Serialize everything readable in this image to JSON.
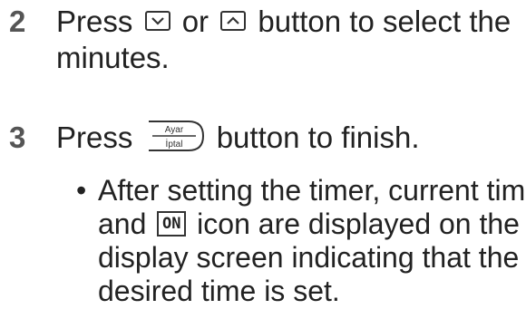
{
  "step2": {
    "number": "2",
    "line1_before": "Press ",
    "or_text": " or ",
    "line1_after": " button to select the",
    "line2": "minutes.",
    "down_button_icon": "chevron-down-icon",
    "up_button_icon": "chevron-up-icon"
  },
  "step3": {
    "number": "3",
    "before": "Press ",
    "after": " button to finish.",
    "button_top_label": "Ayar",
    "button_bottom_label": "İptal"
  },
  "bullet": {
    "dot": "•",
    "line1": "After setting the timer, current time",
    "line2_before": "and ",
    "on_icon_label": "ON",
    "line2_after": " icon are displayed on the",
    "line3": "display screen indicating that the",
    "line4": "desired time is set."
  }
}
